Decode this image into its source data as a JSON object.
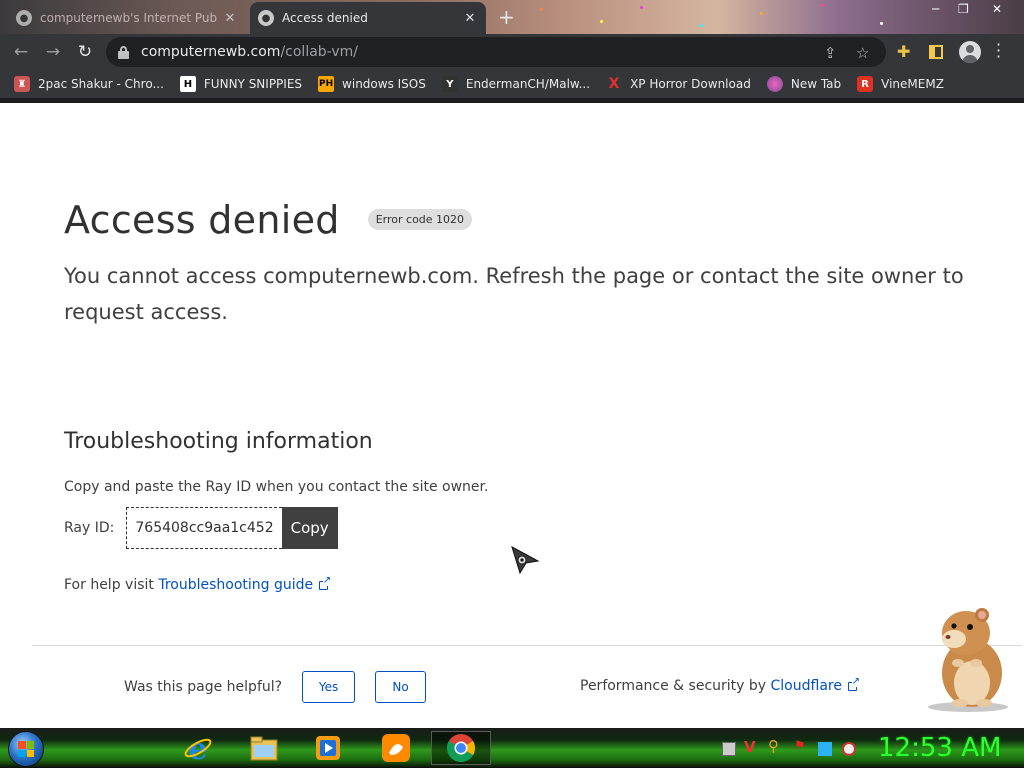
{
  "browser": {
    "tabs": [
      {
        "title": "computernewb's Internet Pub",
        "active": false
      },
      {
        "title": "Access denied",
        "active": true
      }
    ],
    "url": {
      "host": "computernewb.com",
      "path": "/collab-vm/"
    },
    "bookmarks": [
      {
        "label": "2pac Shakur - Chro...",
        "icon": "chrome-icon"
      },
      {
        "label": "FUNNY SNIPPIES",
        "icon": "H"
      },
      {
        "label": "windows ISOS",
        "icon": "PH"
      },
      {
        "label": "EndermanCH/Malw...",
        "icon": "Y"
      },
      {
        "label": "XP Horror Download",
        "icon": "X"
      },
      {
        "label": "New Tab",
        "icon": "globe-icon"
      },
      {
        "label": "VineMEMZ",
        "icon": "R"
      }
    ]
  },
  "page": {
    "title": "Access denied",
    "error_badge": "Error code 1020",
    "subtitle": "You cannot access computernewb.com. Refresh the page or contact the site owner to request access.",
    "troubleshooting_title": "Troubleshooting information",
    "copy_text": "Copy and paste the Ray ID when you contact the site owner.",
    "ray_label": "Ray ID:",
    "ray_id": "765408cc9aa1c452",
    "copy_button": "Copy",
    "help_prefix": "For help visit",
    "help_link": "Troubleshooting guide",
    "helpful_question": "Was this page helpful?",
    "yes_button": "Yes",
    "no_button": "No",
    "perf_prefix": "Performance & security by",
    "perf_link": "Cloudflare"
  },
  "taskbar": {
    "clock": "12:53 AM",
    "apps": [
      "internet-explorer-icon",
      "file-explorer-icon",
      "media-player-icon",
      "uc-browser-icon",
      "chrome-icon"
    ]
  },
  "colors": {
    "link": "#0051c3",
    "text": "#313131",
    "browser_dark": "#35363a",
    "clock_green": "#2fff2f"
  }
}
